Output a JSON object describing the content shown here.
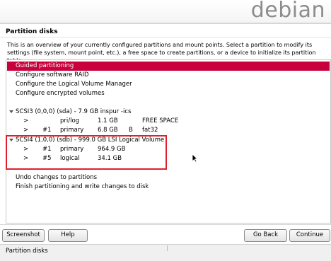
{
  "banner": {
    "logo_text": "debian"
  },
  "page": {
    "title": "Partition disks",
    "intro": "This is an overview of your currently configured partitions and mount points. Select a partition to modify its settings (file system, mount point, etc.), a free space to create partitions, or a device to initialize its partition table."
  },
  "list": {
    "guided": "Guided partitioning",
    "raid": "Configure software RAID",
    "lvm": "Configure the Logical Volume Manager",
    "encrypted": "Configure encrypted volumes",
    "disk1": {
      "label": "SCSI3 (0,0,0) (sda) - 7.9 GB inspur -ics",
      "rows": [
        {
          "arrow": ">",
          "num": "",
          "type": "pri/log",
          "size": "1.1 GB",
          "flag": "",
          "fs": "FREE SPACE"
        },
        {
          "arrow": ">",
          "num": "#1",
          "type": "primary",
          "size": "6.8 GB",
          "flag": "B",
          "fs": "fat32"
        }
      ]
    },
    "disk2": {
      "label": "SCSI4 (1,0,0) (sdb) - 999.0 GB LSI Logical Volume",
      "rows": [
        {
          "arrow": ">",
          "num": "#1",
          "type": "primary",
          "size": "964.9 GB"
        },
        {
          "arrow": ">",
          "num": "#5",
          "type": "logical",
          "size": "34.1 GB"
        }
      ]
    },
    "undo": "Undo changes to partitions",
    "finish": "Finish partitioning and write changes to disk"
  },
  "buttons": {
    "screenshot": "Screenshot",
    "help": "Help",
    "go_back": "Go Back",
    "continue": "Continue"
  },
  "status_bar": {
    "text": "Partition disks"
  },
  "colors": {
    "highlight": "#c8003c",
    "annotation_box": "#e0202a"
  }
}
